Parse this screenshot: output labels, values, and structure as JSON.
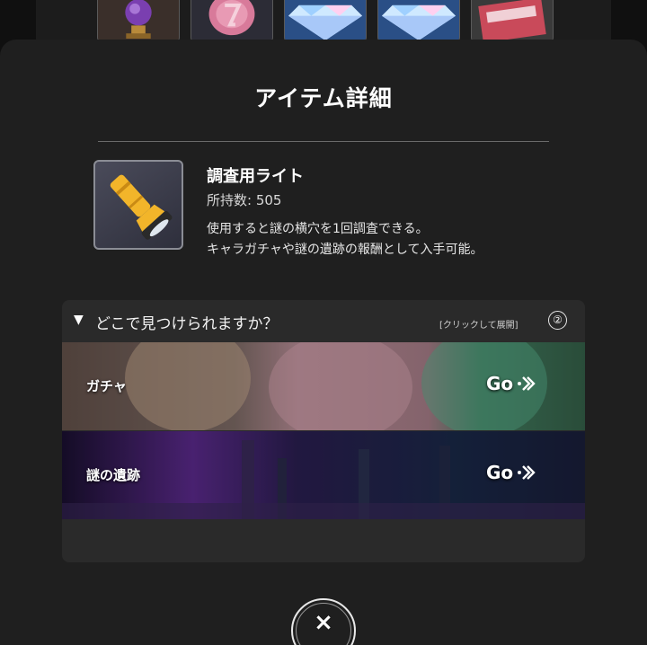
{
  "top_strip": {
    "thumbs": [
      {
        "icon": "crystal-orb-icon"
      },
      {
        "icon": "pink-coin-icon"
      },
      {
        "icon": "diamond-icon"
      },
      {
        "icon": "diamond-icon"
      },
      {
        "icon": "ticket-card-icon"
      }
    ]
  },
  "modal": {
    "title": "アイテム詳細"
  },
  "item": {
    "name": "調査用ライト",
    "count_label": "所持数: 505",
    "description_line1": "使用すると謎の横穴を1回調査できる。",
    "description_line2": "キャラガチャや謎の遺跡の報酬として入手可能。",
    "icon": "flashlight-icon"
  },
  "where": {
    "toggle_glyph": "▼",
    "question": "どこで見つけられますか？",
    "hint": "[クリックして展開]",
    "help_glyph": "②",
    "sources": [
      {
        "label": "ガチャ",
        "go_label": "Go"
      },
      {
        "label": "謎の遺跡",
        "go_label": "Go"
      }
    ]
  },
  "close": {
    "glyph": "×"
  },
  "colors": {
    "modal_bg": "#1f1f1f",
    "panel_bg": "#2a2a2a",
    "flashlight_yellow": "#f2b52a",
    "ruins_purple": "#5b2a8c"
  }
}
